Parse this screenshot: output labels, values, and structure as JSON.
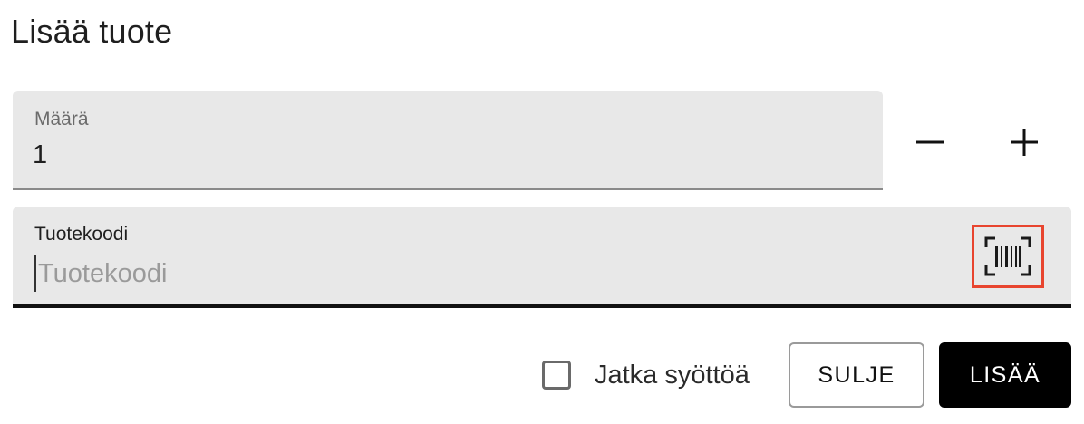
{
  "dialog": {
    "title": "Lisää tuote"
  },
  "quantity": {
    "label": "Määrä",
    "value": "1",
    "decrement_symbol": "−",
    "increment_symbol": "+"
  },
  "product_code": {
    "label": "Tuotekoodi",
    "placeholder": "Tuotekoodi",
    "value": "",
    "scan_icon": "barcode-scan-icon",
    "scan_highlight_color": "#e8452f"
  },
  "footer": {
    "continue_label": "Jatka syöttöä",
    "continue_checked": false,
    "close_label": "SULJE",
    "add_label": "LISÄÄ"
  },
  "colors": {
    "field_bg": "#e8e8e8",
    "primary_button": "#000000",
    "active_underline": "#111111"
  }
}
